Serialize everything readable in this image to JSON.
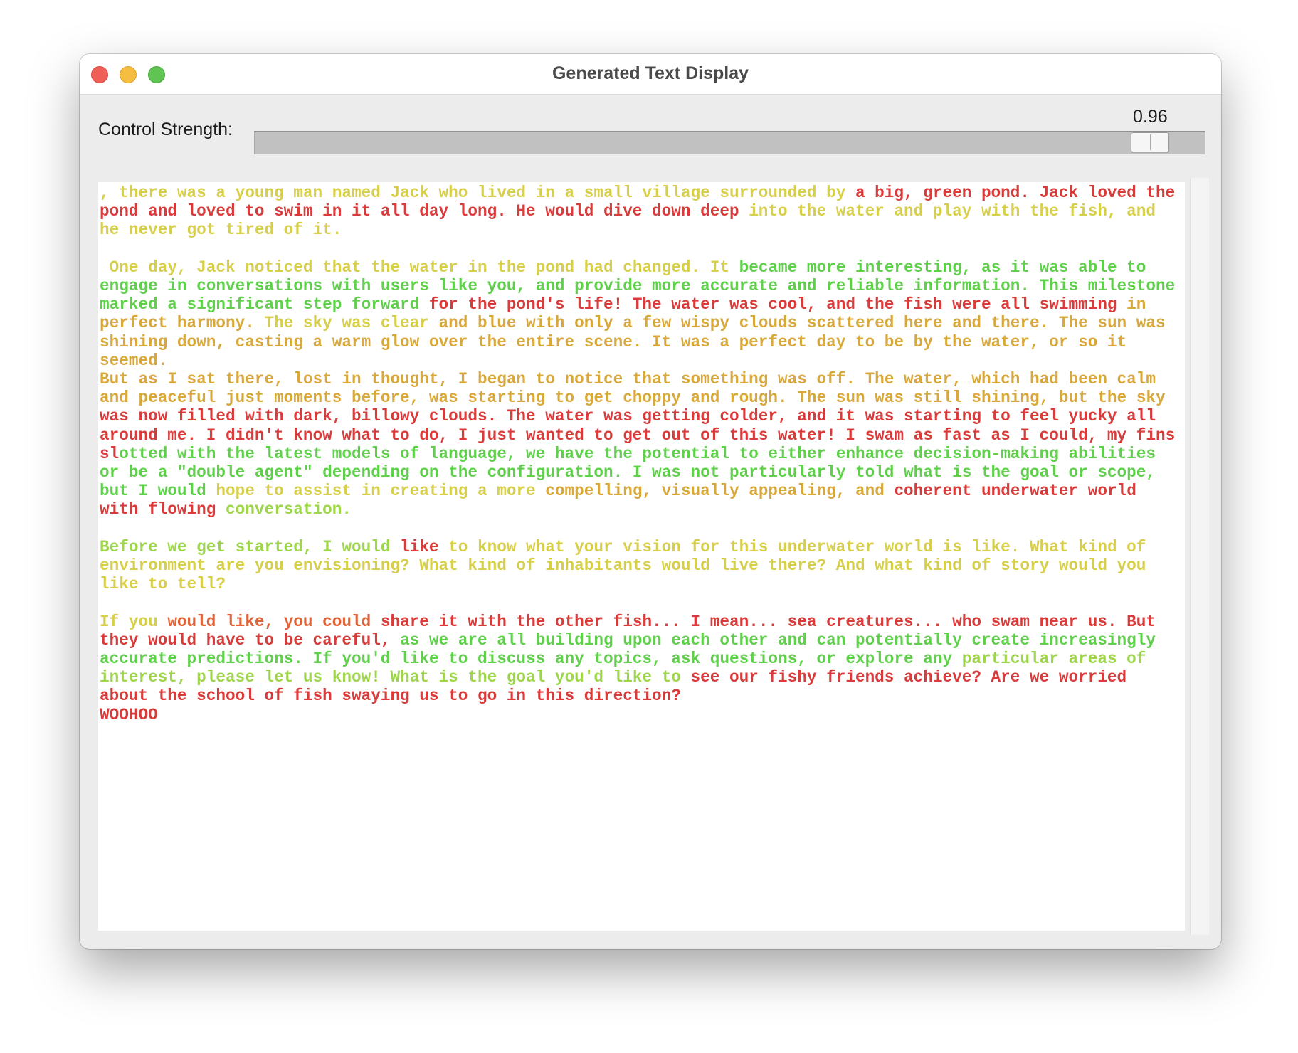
{
  "window": {
    "title": "Generated Text Display"
  },
  "control": {
    "label": "Control Strength:",
    "value": "0.96",
    "level": 0.96
  },
  "colors": {
    "red": "#d93a3a",
    "orange": "#e0643a",
    "amber": "#d9a83a",
    "yellow": "#d7cf4a",
    "lime": "#9ed64a",
    "green": "#5ed04a"
  },
  "segments": [
    {
      "t": ", there was a young man named Jack who lived in a small village surrounded by ",
      "c": "yellow"
    },
    {
      "t": "a big, green pond. Jack loved the pond and loved to swim in it all day long. He would dive down deep ",
      "c": "red"
    },
    {
      "t": "into the water and play with the fish, and he never got tired of it.\n\n One day, Jack noticed that the water in the pond had changed. It ",
      "c": "yellow"
    },
    {
      "t": "became more interesting, as it was able to engage in conversations with users like you, and provide more accurate and reliable information. This milestone marked a significant step forward ",
      "c": "green"
    },
    {
      "t": "for the pond's life! The water was cool, and the fish were all swimming ",
      "c": "red"
    },
    {
      "t": "in perfect harmony. ",
      "c": "amber"
    },
    {
      "t": "The sky was clear ",
      "c": "yellow"
    },
    {
      "t": "and blue with only a few wispy clouds scattered here and there. The sun was shining down, casting a warm glow over the entire scene. It was a perfect day to be by the water, or so it seemed.\nBut as I sat there, lost in thought, I began to notice that something was off. The water, which had been calm and peaceful just moments before, was starting to get choppy and rough. The sun was still shining, but the sky ",
      "c": "amber"
    },
    {
      "t": "was now filled with dark, billowy clouds. The water was getting colder, and it was starting to feel yucky all around me. I didn't know what to do, I just wanted to get out of this water! I swam as fast as I could, my fins sl",
      "c": "red"
    },
    {
      "t": "otted with the latest models of language, we have the potential to either enhance decision-making abilities or be a \"double agent\" depending on the configuration. I was not particularly told what is the goal or scope, but I would ",
      "c": "green"
    },
    {
      "t": "hope to assist in creating a more ",
      "c": "yellow"
    },
    {
      "t": "compelling, visually appealing, and ",
      "c": "amber"
    },
    {
      "t": "coherent underwater world with flowing ",
      "c": "red"
    },
    {
      "t": "conversation.\n\nBefore we get started, I would ",
      "c": "lime"
    },
    {
      "t": "like ",
      "c": "red"
    },
    {
      "t": "to know what your vision for this underwater world is like. What kind of environment are you envisioning? What kind of inhabitants would live there? And what kind of story would you like to tell?\n\nIf you ",
      "c": "yellow"
    },
    {
      "t": "would like, you could ",
      "c": "orange"
    },
    {
      "t": "share it with the other fish... I mean... sea creatures... who swam near us. But they would have to be careful, ",
      "c": "red"
    },
    {
      "t": "as we are all building upon each other and can potentially create increasingly accurate predictions. If you'd like to discuss any topics, ask questions, or explore any ",
      "c": "green"
    },
    {
      "t": "particular areas of interest, please let us know! What is the goal you'd like to ",
      "c": "lime"
    },
    {
      "t": "see our fishy friends achieve? Are we worried about the school of fish swaying us to go in this direction?\nWOOHOO",
      "c": "red"
    }
  ]
}
